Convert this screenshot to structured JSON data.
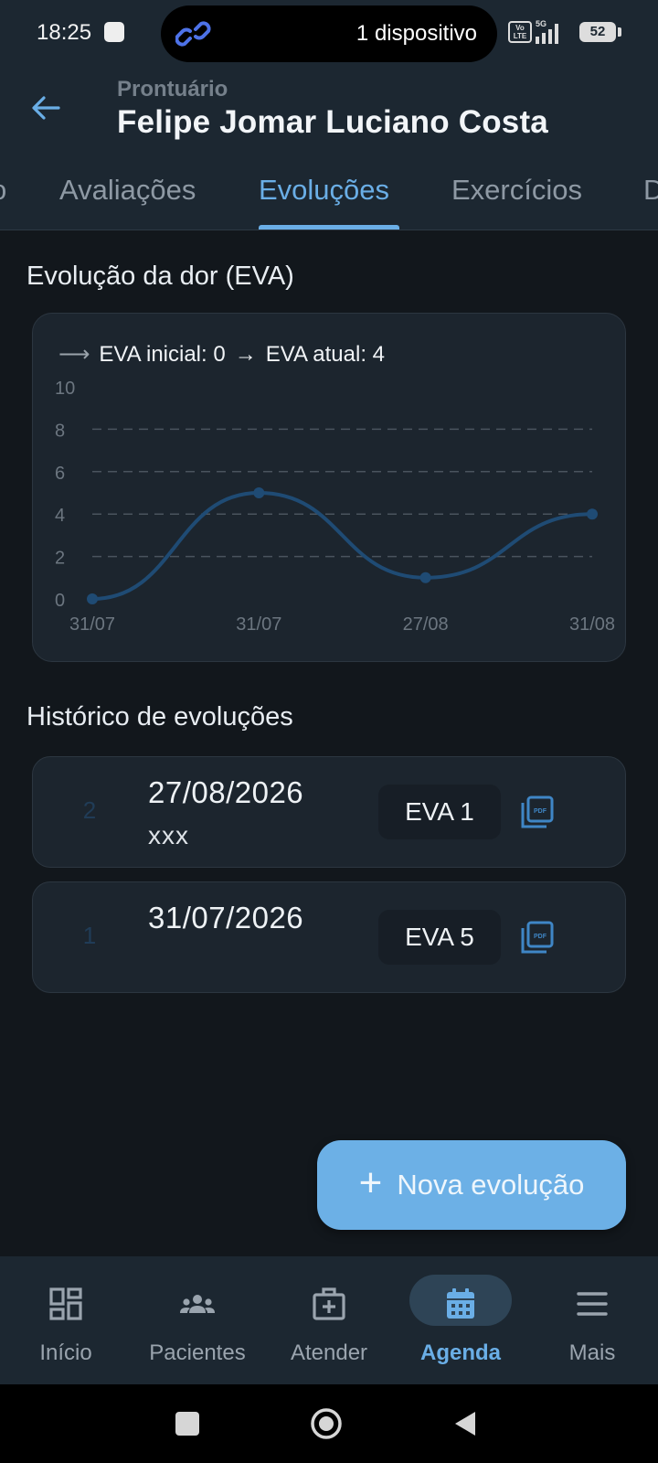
{
  "status_bar": {
    "time": "18:25",
    "devices": "1 dispositivo",
    "volte_label": "Vo LTE",
    "network": "5G",
    "battery": "52"
  },
  "header": {
    "subtitle": "Prontuário",
    "title": "Felipe Jomar Luciano Costa"
  },
  "tabs": [
    {
      "label": "o",
      "active": false
    },
    {
      "label": "Avaliações",
      "active": false
    },
    {
      "label": "Evoluções",
      "active": true
    },
    {
      "label": "Exercícios",
      "active": false
    },
    {
      "label": "D",
      "active": false
    }
  ],
  "pain_section": {
    "title": "Evolução da dor (EVA)",
    "summary_start": "EVA inicial: 0",
    "summary_current": "EVA atual: 4"
  },
  "chart_data": {
    "type": "line",
    "x": [
      "31/07",
      "31/07",
      "27/08",
      "31/08"
    ],
    "series": [
      {
        "values": [
          0,
          5,
          1,
          4
        ]
      }
    ],
    "ylim": [
      0,
      10
    ],
    "yticks": [
      0,
      2,
      4,
      6,
      8,
      10
    ],
    "grid": true,
    "line_color": "#1f4b74"
  },
  "history": {
    "title": "Histórico de evoluções",
    "items": [
      {
        "number": "2",
        "date": "27/08/2026",
        "note": "xxx",
        "eva": "EVA 1"
      },
      {
        "number": "1",
        "date": "31/07/2026",
        "note": "",
        "eva": "EVA 5"
      }
    ]
  },
  "fab": {
    "label": "Nova evolução"
  },
  "bottom_nav": [
    {
      "label": "Início",
      "icon": "dashboard-icon",
      "active": false
    },
    {
      "label": "Pacientes",
      "icon": "people-icon",
      "active": false
    },
    {
      "label": "Atender",
      "icon": "medical-kit-icon",
      "active": false
    },
    {
      "label": "Agenda",
      "icon": "calendar-icon",
      "active": true
    },
    {
      "label": "Mais",
      "icon": "menu-icon",
      "active": false
    }
  ],
  "colors": {
    "accent": "#6aaee6",
    "header_bg": "#1c2731",
    "page_bg": "#12171c",
    "card_bg": "#1c252e",
    "fab_bg": "#6cb0e6"
  }
}
